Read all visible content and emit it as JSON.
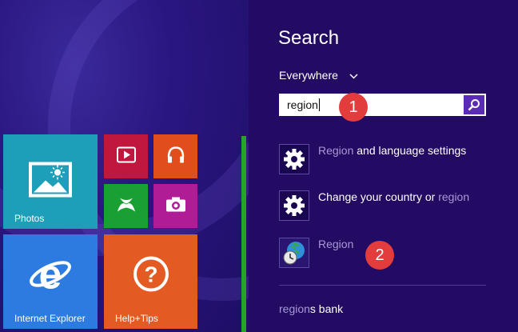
{
  "start": {
    "tiles": [
      {
        "label": "Photos",
        "color": "#1e9fb9",
        "icon": "photos-icon"
      },
      {
        "label": "",
        "color": "#c0173f",
        "icon": "video-icon"
      },
      {
        "label": "",
        "color": "#e24e1b",
        "icon": "music-icon"
      },
      {
        "label": "",
        "color": "#19a032",
        "icon": "games-icon"
      },
      {
        "label": "",
        "color": "#b01c95",
        "icon": "camera-icon"
      },
      {
        "label": "Internet Explorer",
        "color": "#2d7ae0",
        "icon": "internet-explorer-icon"
      },
      {
        "label": "Help+Tips",
        "color": "#e35b23",
        "icon": "help-icon"
      }
    ]
  },
  "search": {
    "title": "Search",
    "scope": "Everywhere",
    "query": "region",
    "button_icon": "magnifier-icon"
  },
  "results": [
    {
      "match": "Region",
      "rest": " and language settings",
      "icon": "gear-icon"
    },
    {
      "before": "Change your country or ",
      "match": "region",
      "icon": "gear-icon"
    },
    {
      "label": "Region",
      "icon": "globe-clock-icon"
    }
  ],
  "suggestion": {
    "match": "region",
    "rest": "s bank"
  },
  "badges": {
    "one": "1",
    "two": "2"
  }
}
